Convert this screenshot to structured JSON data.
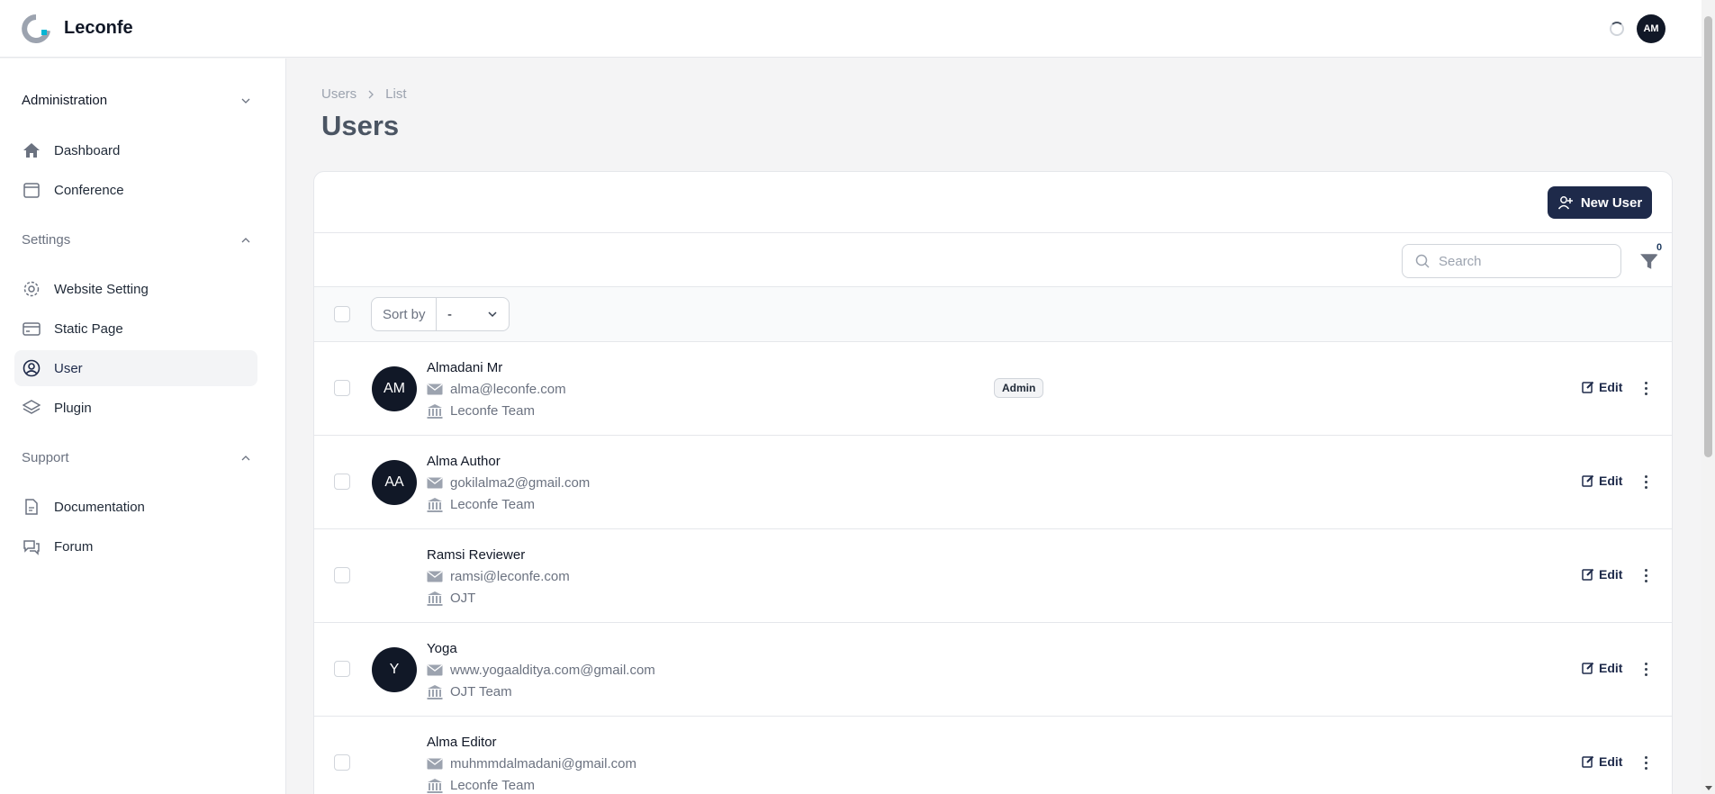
{
  "app": {
    "name": "Leconfe",
    "user_initials": "AM"
  },
  "sidebar": {
    "groups": [
      {
        "label": "Administration",
        "expanded": true,
        "items": [
          {
            "label": "Dashboard",
            "icon": "home-icon"
          },
          {
            "label": "Conference",
            "icon": "calendar-icon"
          }
        ]
      },
      {
        "label": "Settings",
        "expanded": true,
        "items": [
          {
            "label": "Website Setting",
            "icon": "gear-icon"
          },
          {
            "label": "Static Page",
            "icon": "card-icon"
          },
          {
            "label": "User",
            "icon": "user-circle-icon",
            "active": true
          },
          {
            "label": "Plugin",
            "icon": "stack-icon"
          }
        ]
      },
      {
        "label": "Support",
        "expanded": true,
        "items": [
          {
            "label": "Documentation",
            "icon": "document-icon"
          },
          {
            "label": "Forum",
            "icon": "chat-icon"
          }
        ]
      }
    ]
  },
  "breadcrumb": [
    "Users",
    "List"
  ],
  "page": {
    "title": "Users",
    "new_user_label": "New User"
  },
  "toolbar": {
    "search_placeholder": "Search",
    "filter_count": "0",
    "sort_label": "Sort by",
    "sort_value": "-"
  },
  "users": [
    {
      "initials": "AM",
      "name": "Almadani Mr",
      "email": "alma@leconfe.com",
      "affiliation": "Leconfe Team",
      "role": "Admin",
      "has_avatar": true
    },
    {
      "initials": "AA",
      "name": "Alma Author",
      "email": "gokilalma2@gmail.com",
      "affiliation": "Leconfe Team",
      "role": "",
      "has_avatar": true
    },
    {
      "initials": "",
      "name": "Ramsi Reviewer",
      "email": "ramsi@leconfe.com",
      "affiliation": "OJT",
      "role": "",
      "has_avatar": false
    },
    {
      "initials": "Y",
      "name": "Yoga",
      "email": "www.yogaalditya.com@gmail.com",
      "affiliation": "OJT Team",
      "role": "",
      "has_avatar": true
    },
    {
      "initials": "",
      "name": "Alma Editor",
      "email": "muhmmdalmadani@gmail.com",
      "affiliation": "Leconfe Team",
      "role": "",
      "has_avatar": false
    }
  ],
  "row_action_label": "Edit",
  "colors": {
    "primary": "#1e2a4a",
    "logo_accent": "#06b6d4"
  }
}
